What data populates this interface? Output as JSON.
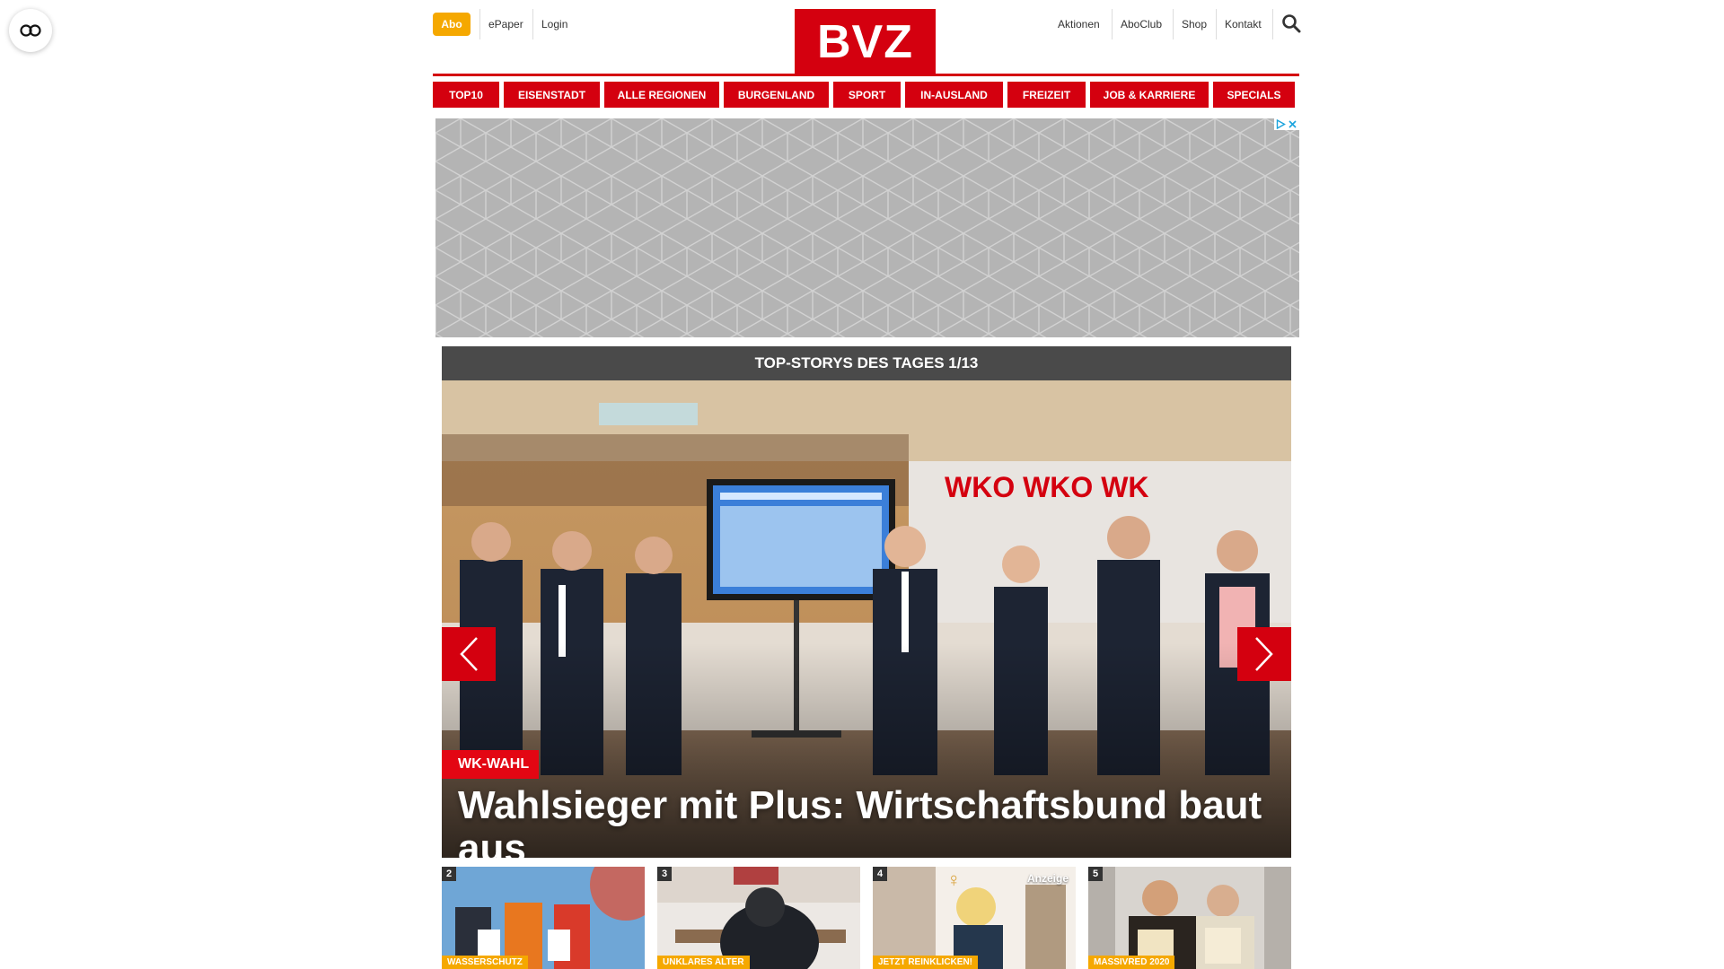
{
  "accessibility": {
    "icon": "eye-glasses-icon"
  },
  "header": {
    "abo_label": "Abo",
    "left_links": [
      "ePaper",
      "Login"
    ],
    "logo_text": "BVZ",
    "right_links": [
      "Aktionen",
      "AboClub",
      "Shop",
      "Kontakt"
    ],
    "search_icon": "search-icon"
  },
  "nav": {
    "items": [
      "TOP10",
      "EISENSTADT",
      "ALLE REGIONEN",
      "BURGENLAND",
      "SPORT",
      "IN-AUSLAND",
      "FREIZEIT",
      "JOB & KARRIERE",
      "SPECIALS"
    ]
  },
  "ad": {
    "badge_icons": [
      "adchoices-icon",
      "close-icon"
    ]
  },
  "carousel": {
    "title": "TOP-STORYS DES TAGES 1/13",
    "category": "WK-WAHL",
    "headline": "Wahlsieger mit Plus: Wirtschaftsbund baut aus"
  },
  "teasers": [
    {
      "num": "2",
      "tag": "WASSERSCHUTZ",
      "ad_label": ""
    },
    {
      "num": "3",
      "tag": "UNKLARES ALTER",
      "ad_label": ""
    },
    {
      "num": "4",
      "tag": "JETZT REINKLICKEN!",
      "ad_label": "Anzeige"
    },
    {
      "num": "5",
      "tag": "MASSIVRED 2020",
      "ad_label": ""
    }
  ],
  "colors": {
    "brand_red": "#d4000f",
    "abo_orange": "#f5a800",
    "header_gray": "#4a4a4a"
  }
}
